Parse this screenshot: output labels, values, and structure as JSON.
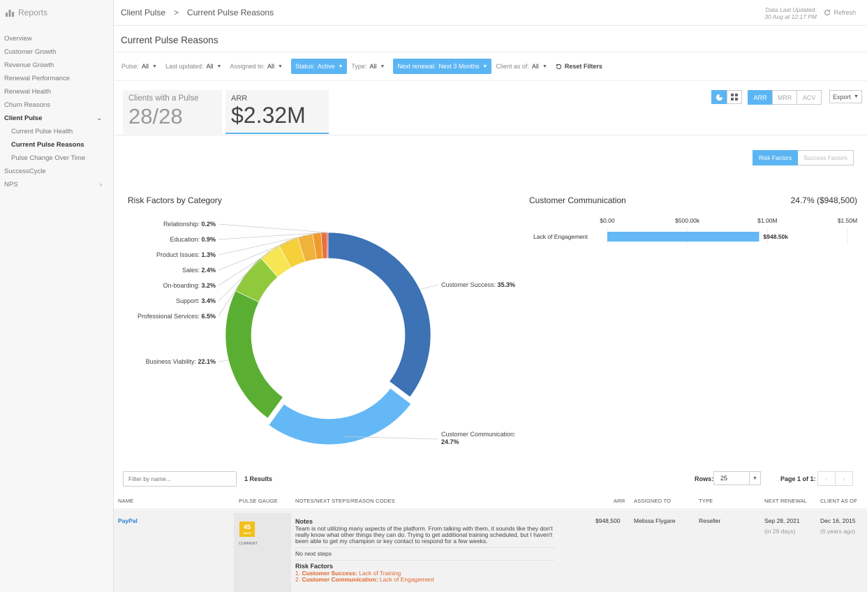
{
  "brand": {
    "title": "Reports"
  },
  "sidebar": {
    "items": [
      {
        "label": "Overview"
      },
      {
        "label": "Customer Growth"
      },
      {
        "label": "Revenue Growth"
      },
      {
        "label": "Renewal Performance"
      },
      {
        "label": "Renewal Health"
      },
      {
        "label": "Churn Reasons"
      },
      {
        "label": "Client Pulse"
      },
      {
        "label": "Current Pulse Health"
      },
      {
        "label": "Current Pulse Reasons"
      },
      {
        "label": "Pulse Change Over Time"
      },
      {
        "label": "SuccessCycle"
      },
      {
        "label": "NPS"
      }
    ]
  },
  "breadcrumb": {
    "parent": "Client Pulse",
    "current": "Current Pulse Reasons"
  },
  "updated": {
    "label": "Data Last Updated:",
    "value": "30 Aug at 12:17 PM"
  },
  "refresh_label": "Refresh",
  "page_title": "Current Pulse Reasons",
  "filters": [
    {
      "label": "Pulse:",
      "value": "All"
    },
    {
      "label": "Last updated:",
      "value": "All"
    },
    {
      "label": "Assigned to:",
      "value": "All"
    },
    {
      "label": "Status:",
      "value": "Active"
    },
    {
      "label": "Type:",
      "value": "All"
    },
    {
      "label": "Next renewal:",
      "value": "Next 3 Months"
    },
    {
      "label": "Client as of:",
      "value": "All"
    }
  ],
  "reset_label": "Reset Filters",
  "kpis": {
    "clients": {
      "label": "Clients with a Pulse",
      "value": "28/28"
    },
    "arr": {
      "label": "ARR",
      "value": "$2.32M"
    }
  },
  "metric_toggle": [
    "ARR",
    "MRR",
    "ACV"
  ],
  "export_label": "Export",
  "factor_toggle": {
    "risk": "Risk Factors",
    "success": "Success Factors"
  },
  "risk_chart": {
    "title": "Risk Factors by Category"
  },
  "comm": {
    "title": "Customer Communication",
    "value": "24.7% ($948,500)"
  },
  "chart_data": [
    {
      "type": "pie",
      "title": "Risk Factors by Category",
      "categories": [
        "Customer Success",
        "Customer Communication",
        "Business Viability",
        "Professional Services",
        "Support",
        "On-boarding",
        "Sales",
        "Product Issues",
        "Education",
        "Relationship"
      ],
      "values": [
        35.3,
        24.7,
        22.1,
        6.5,
        3.4,
        3.2,
        2.4,
        1.3,
        0.9,
        0.2
      ],
      "labels": [
        "35.3%",
        "24.7%",
        "22.1%",
        "6.5%",
        "3.4%",
        "3.2%",
        "2.4%",
        "1.3%",
        "0.9%",
        "0.2%"
      ],
      "colors": [
        "#3d72b4",
        "#64b8f6",
        "#5aaf32",
        "#91c93c",
        "#f7e654",
        "#f6d03a",
        "#efb23a",
        "#ef9a2c",
        "#e8703a",
        "#d94b5c"
      ]
    },
    {
      "type": "bar",
      "title": "Customer Communication",
      "categories": [
        "Lack of Engagement"
      ],
      "values": [
        948500
      ],
      "value_labels": [
        "$948.50k"
      ],
      "xlim": [
        0,
        1500000
      ],
      "ticks": [
        "$0.00",
        "$500.00k",
        "$1.00M",
        "$1.50M"
      ],
      "color": "#64b8f6"
    }
  ],
  "table": {
    "filter_placeholder": "Filter by name...",
    "results": "1 Results",
    "rows_label": "Rows:",
    "rows_value": "25",
    "page_info": "Page 1 of 1:",
    "headers": [
      "NAME",
      "PULSE GAUGE",
      "NOTES/NEXT STEPS/REASON CODES",
      "ARR",
      "ASSIGNED TO",
      "TYPE",
      "NEXT RENEWAL",
      "CLIENT AS OF"
    ],
    "row": {
      "name": "PayPal",
      "gauge_days": "45",
      "gauge_unit": "DAYS",
      "gauge_label": "CURRENT",
      "notes_title": "Notes",
      "notes_text": "Team is not utilizing many aspects of the platform. From talking with them, it sounds like they don't really know what other things they can do. Trying to get additional training scheduled, but I haven't been able to get my champion or key contact to respond for a few weeks.",
      "next_steps": "No next steps",
      "risk_title": "Risk Factors",
      "risk1_cat": "Customer Success:",
      "risk1_val": "Lack of Training",
      "risk2_cat": "Customer Communication:",
      "risk2_val": "Lack of Engagement",
      "arr": "$948,500",
      "assigned": "Melissa Flygare",
      "type": "Reseller",
      "renewal": "Sep 28, 2021",
      "renewal_sub": "(in 29 days)",
      "client_as_of": "Dec 16, 2015",
      "client_sub": "(6 years ago)"
    }
  }
}
